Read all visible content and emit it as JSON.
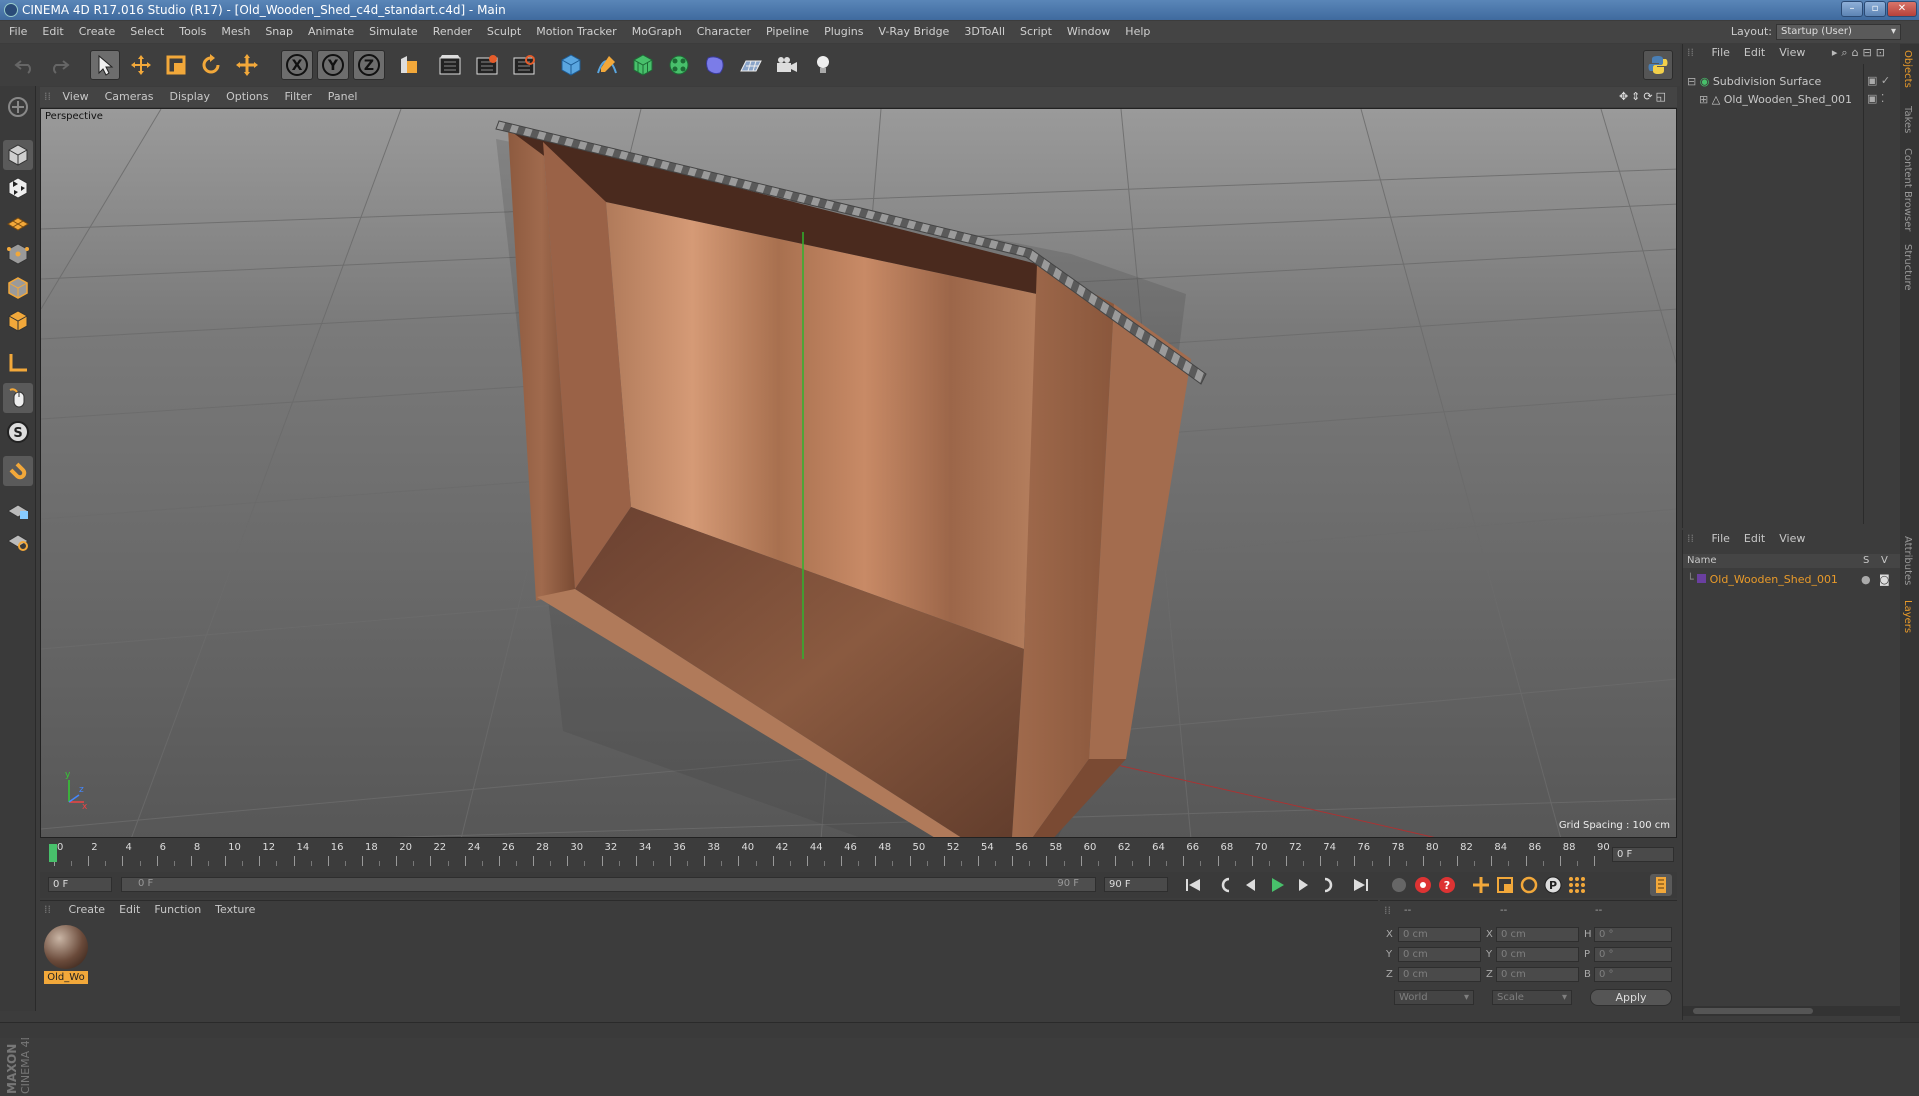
{
  "window": {
    "title": "CINEMA 4D R17.016 Studio (R17) - [Old_Wooden_Shed_c4d_standart.c4d] - Main",
    "minimize": "–",
    "maximize": "▫",
    "close": "✕"
  },
  "menubar": {
    "items": [
      "File",
      "Edit",
      "Create",
      "Select",
      "Tools",
      "Mesh",
      "Snap",
      "Animate",
      "Simulate",
      "Render",
      "Sculpt",
      "Motion Tracker",
      "MoGraph",
      "Character",
      "Pipeline",
      "Plugins",
      "V-Ray Bridge",
      "3DToAll",
      "Script",
      "Window",
      "Help"
    ],
    "layout_label": "Layout:",
    "layout_value": "Startup (User)"
  },
  "toolbar": {
    "icons": [
      "undo-icon",
      "redo-icon",
      "select-pointer-icon",
      "move-icon",
      "scale-icon",
      "rotate-icon",
      "live-select-icon",
      "axis-x-icon",
      "axis-y-icon",
      "axis-z-icon",
      "coordinate-system-icon",
      "render-view-icon",
      "render-picture-viewer-icon",
      "edit-render-settings-icon",
      "cube-primitive-icon",
      "pen-spline-icon",
      "subdivision-generator-icon",
      "array-cloner-icon",
      "deformer-icon",
      "floor-grid-icon",
      "camera-icon",
      "light-icon"
    ],
    "axis_x": "X",
    "axis_y": "Y",
    "axis_z": "Z"
  },
  "viewport": {
    "menu": [
      "View",
      "Cameras",
      "Display",
      "Options",
      "Filter",
      "Panel"
    ],
    "label": "Perspective",
    "grid_spacing": "Grid Spacing : 100 cm"
  },
  "timeline": {
    "ticks": [
      "0",
      "2",
      "4",
      "6",
      "8",
      "10",
      "12",
      "14",
      "16",
      "18",
      "20",
      "22",
      "24",
      "26",
      "28",
      "30",
      "32",
      "34",
      "36",
      "38",
      "40",
      "42",
      "44",
      "46",
      "48",
      "50",
      "52",
      "54",
      "56",
      "58",
      "60",
      "62",
      "64",
      "66",
      "68",
      "70",
      "72",
      "74",
      "76",
      "78",
      "80",
      "82",
      "84",
      "86",
      "88",
      "90"
    ],
    "current_frame": "0 F",
    "start_field": "0 F",
    "range_start": "0 F",
    "range_end": "90 F",
    "end_field": "90 F"
  },
  "materials": {
    "menu": [
      "Create",
      "Edit",
      "Function",
      "Texture"
    ],
    "items": [
      {
        "name": "Old_Wo"
      }
    ]
  },
  "coordinates": {
    "headers": [
      "--",
      "--",
      "--"
    ],
    "rows": [
      {
        "a": "X",
        "av": "0 cm",
        "b": "X",
        "bv": "0 cm",
        "c": "H",
        "cv": "0 °"
      },
      {
        "a": "Y",
        "av": "0 cm",
        "b": "Y",
        "bv": "0 cm",
        "c": "P",
        "cv": "0 °"
      },
      {
        "a": "Z",
        "av": "0 cm",
        "b": "Z",
        "bv": "0 cm",
        "c": "B",
        "cv": "0 °"
      }
    ],
    "mode1": "World",
    "mode2": "Scale",
    "apply": "Apply"
  },
  "objects": {
    "menu": [
      "File",
      "Edit",
      "View"
    ],
    "tree": [
      {
        "name": "Subdivision Surface",
        "color": "#9fd39f"
      },
      {
        "name": "Old_Wooden_Shed_001",
        "color": "#c8c8c8"
      }
    ]
  },
  "layers": {
    "menu": [
      "File",
      "Edit",
      "View"
    ],
    "col_name": "Name",
    "col_s": "S",
    "col_v": "V",
    "items": [
      {
        "name": "Old_Wooden_Shed_001",
        "color": "#e89a2a"
      }
    ]
  },
  "right_tabs": [
    "Objects",
    "Takes",
    "Content Browser",
    "Structure",
    "Attributes",
    "Layers"
  ],
  "brand": {
    "logo_text": "MAXON CINEMA 4D"
  }
}
